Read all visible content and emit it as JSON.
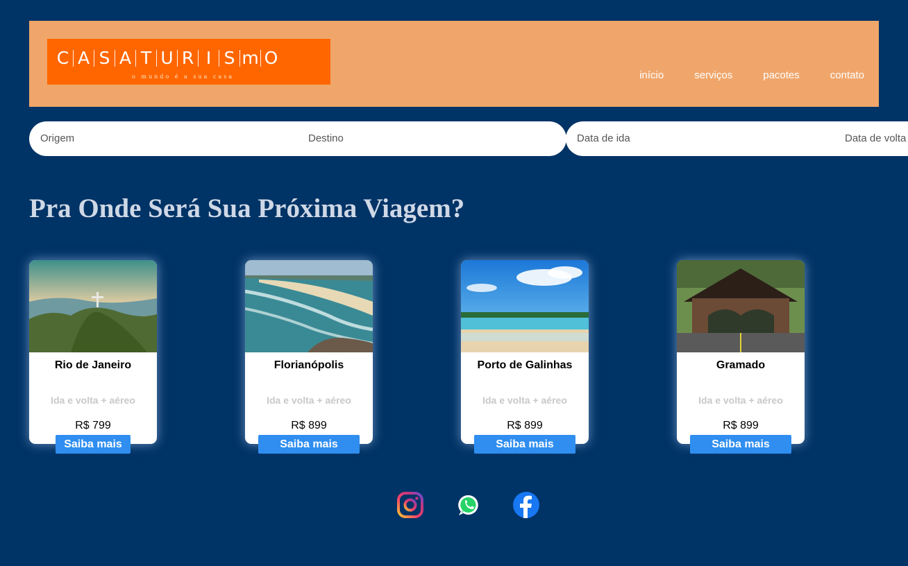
{
  "brand": {
    "letters": [
      "C",
      "A",
      "S",
      "A",
      "T",
      "U",
      "R",
      "I",
      "S",
      "m",
      "O"
    ],
    "tagline": "o mundo é a sua casa",
    "colors": {
      "logo_bg": "#ff6600",
      "header_bg": "#f0a66b",
      "page_bg": "#003366"
    }
  },
  "nav": {
    "items": [
      "início",
      "serviços",
      "pacotes",
      "contato"
    ]
  },
  "search": {
    "origin": "Origem",
    "destination": "Destino",
    "departure": "Data de ida",
    "return": "Data de volta"
  },
  "main": {
    "title": "Pra Onde Será Sua Próxima Viagem?"
  },
  "cards": [
    {
      "name": "Rio de Janeiro",
      "subtitle": "Ida e volta + aéreo",
      "price": "R$ 799",
      "button": "Saiba mais",
      "image_icon": "rio-christ-redeemer-image"
    },
    {
      "name": "Florianópolis",
      "subtitle": "Ida e volta + aéreo",
      "price": "R$ 899",
      "button": "Saiba mais",
      "image_icon": "florianopolis-beach-image"
    },
    {
      "name": "Porto de Galinhas",
      "subtitle": "Ida e volta + aéreo",
      "price": "R$ 899",
      "button": "Saiba mais",
      "image_icon": "porto-galinhas-beach-image"
    },
    {
      "name": "Gramado",
      "subtitle": "Ida e volta + aéreo",
      "price": "R$ 899",
      "button": "Saiba mais",
      "image_icon": "gramado-portal-image"
    }
  ],
  "social": {
    "icons": [
      "instagram-icon",
      "whatsapp-icon",
      "facebook-icon"
    ]
  }
}
